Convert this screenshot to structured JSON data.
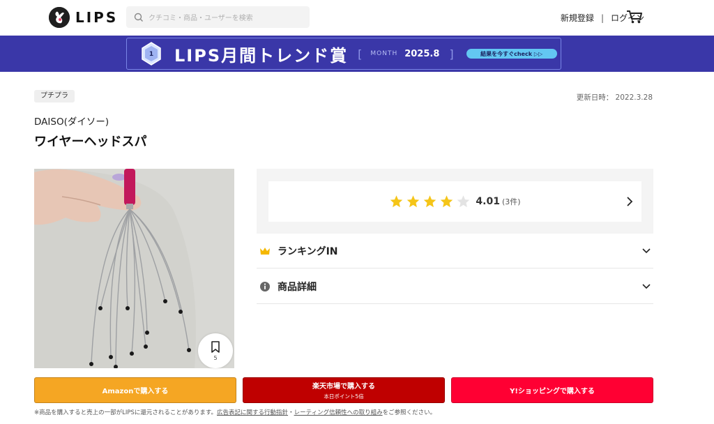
{
  "header": {
    "logo_text": "LIPS",
    "search_placeholder": "クチコミ・商品・ユーザーを検索",
    "signup": "新規登録",
    "separator": "|",
    "login": "ログイン",
    "cart_icon": "cart-icon"
  },
  "banner": {
    "title": "LIPS月間トレンド賞",
    "bracket_open": "[",
    "month_label": "MONTH",
    "month_value": "2025.8",
    "bracket_close": "]",
    "cta": "結果を今すぐcheck ▷▷",
    "background_color": "#3a37a8"
  },
  "product": {
    "category_tag": "プチプラ",
    "updated": "更新日時： 2022.3.28",
    "brand": "DAISO(ダイソー)",
    "name": "ワイヤーヘッドスパ",
    "bookmark_count": "5"
  },
  "rating": {
    "score": "4.01",
    "count": "(3件)",
    "stars_filled": 4,
    "stars_total": 5,
    "star_color": "#f5c518"
  },
  "accordion": [
    {
      "label": "ランキングIN",
      "icon": "crown-icon"
    },
    {
      "label": "商品詳細",
      "icon": "info-icon"
    }
  ],
  "buy_buttons": [
    {
      "label": "Amazonで購入する",
      "sub": "",
      "color": "#f5a623"
    },
    {
      "label": "楽天市場で購入する",
      "sub": "本日ポイント5倍",
      "color": "#bf0000"
    },
    {
      "label": "Y!ショッピングで購入する",
      "sub": "",
      "color": "#ff0033"
    }
  ],
  "footnote": {
    "prefix": "※商品を購入すると売上の一部がLIPSに還元されることがあります。",
    "link1": "広告表記に関する行動指針",
    "middle": "・",
    "link2": "レーティング信頼性への取り組み",
    "suffix": "をご参照ください。"
  }
}
